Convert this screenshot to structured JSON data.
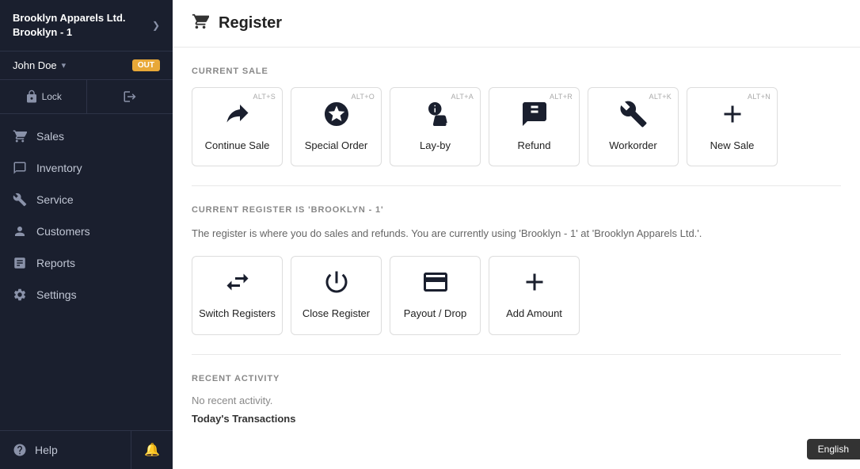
{
  "brand": {
    "company": "Brooklyn Apparels Ltd.",
    "location": "Brooklyn - 1",
    "arrow": "❯"
  },
  "user": {
    "name": "John Doe",
    "status": "OUT"
  },
  "sidebar": {
    "nav_items": [
      {
        "id": "sales",
        "label": "Sales",
        "icon": "sales"
      },
      {
        "id": "inventory",
        "label": "Inventory",
        "icon": "inventory"
      },
      {
        "id": "service",
        "label": "Service",
        "icon": "service"
      },
      {
        "id": "customers",
        "label": "Customers",
        "icon": "customers"
      },
      {
        "id": "reports",
        "label": "Reports",
        "icon": "reports"
      },
      {
        "id": "settings",
        "label": "Settings",
        "icon": "settings"
      }
    ],
    "help_label": "Help"
  },
  "main": {
    "header_title": "Register",
    "sections": {
      "current_sale": {
        "title": "CURRENT SALE",
        "cards": [
          {
            "id": "continue-sale",
            "label": "Continue Sale",
            "shortcut": "ALT+S"
          },
          {
            "id": "special-order",
            "label": "Special Order",
            "shortcut": "ALT+O"
          },
          {
            "id": "lay-by",
            "label": "Lay-by",
            "shortcut": "ALT+A"
          },
          {
            "id": "refund",
            "label": "Refund",
            "shortcut": "ALT+R"
          },
          {
            "id": "workorder",
            "label": "Workorder",
            "shortcut": "ALT+K"
          },
          {
            "id": "new-sale",
            "label": "New Sale",
            "shortcut": "ALT+N"
          }
        ]
      },
      "current_register": {
        "title": "CURRENT REGISTER IS 'BROOKLYN - 1'",
        "info_text": "The register is where you do sales and refunds. You are currently using 'Brooklyn - 1'  at 'Brooklyn Apparels Ltd.'.",
        "cards": [
          {
            "id": "switch-registers",
            "label": "Switch Registers"
          },
          {
            "id": "close-register",
            "label": "Close Register"
          },
          {
            "id": "payout-drop",
            "label": "Payout / Drop"
          },
          {
            "id": "add-amount",
            "label": "Add Amount"
          }
        ]
      },
      "recent_activity": {
        "title": "RECENT ACTIVITY",
        "empty_text": "No recent activity.",
        "today_label": "Today's Transactions"
      }
    }
  },
  "lang": {
    "label": "English"
  }
}
